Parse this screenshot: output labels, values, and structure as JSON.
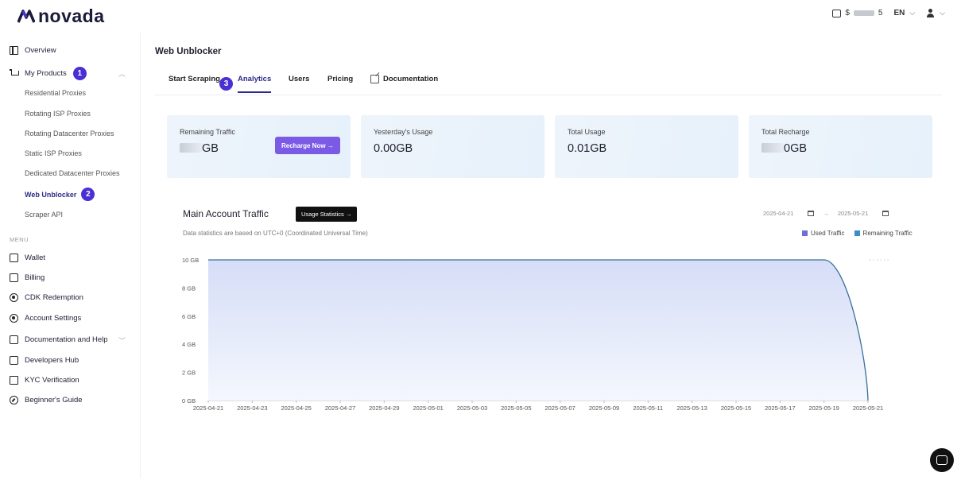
{
  "header": {
    "logo_text": "novada",
    "balance_prefix": "$",
    "balance_suffix": "5",
    "language": "EN"
  },
  "sidebar": {
    "overview": "Overview",
    "my_products": "My Products",
    "products_badge": "1",
    "products": [
      "Residential Proxies",
      "Rotating ISP Proxies",
      "Rotating Datacenter Proxies",
      "Static ISP Proxies",
      "Dedicated Datacenter Proxies",
      "Web Unblocker",
      "Scraper API"
    ],
    "active_product_badge": "2",
    "menu_label": "MENU",
    "menu": [
      "Wallet",
      "Billing",
      "CDK Redemption",
      "Account Settings",
      "Documentation and Help",
      "Developers Hub",
      "KYC Verification",
      "Beginner's Guide"
    ]
  },
  "page": {
    "title": "Web Unblocker",
    "tabs": [
      "Start Scraping",
      "Analytics",
      "Users",
      "Pricing",
      "Documentation"
    ],
    "tab_badge": "3"
  },
  "cards": [
    {
      "label": "Remaining Traffic",
      "value_suffix": "GB",
      "button": "Recharge Now →"
    },
    {
      "label": "Yesterday's Usage",
      "value": "0.00GB"
    },
    {
      "label": "Total Usage",
      "value": "0.01GB"
    },
    {
      "label": "Total Recharge",
      "value_suffix": "0GB"
    }
  ],
  "chart_section": {
    "title": "Main Account Traffic",
    "button": "Usage Statistics →",
    "note": "Data statistics are based on UTC+0 (Coordinated Universal Time)",
    "date_from": "2025-04-21",
    "date_sep": "→",
    "date_to": "2025-05-21"
  },
  "colors": {
    "accent": "#2d2b8a",
    "badge": "#4a2fd4",
    "used_traffic": "#6b6fd6",
    "remaining_traffic": "#3a8fc8",
    "recharge_button": "#7b5be6"
  },
  "chart_data": {
    "type": "area",
    "x": [
      "2025-04-21",
      "2025-04-23",
      "2025-04-25",
      "2025-04-27",
      "2025-04-29",
      "2025-05-01",
      "2025-05-03",
      "2025-05-05",
      "2025-05-07",
      "2025-05-09",
      "2025-05-11",
      "2025-05-13",
      "2025-05-15",
      "2025-05-17",
      "2025-05-19",
      "2025-05-21"
    ],
    "y_ticks": [
      "0 GB",
      "2 GB",
      "4 GB",
      "6 GB",
      "8 GB",
      "10 GB"
    ],
    "ylim": [
      0,
      10
    ],
    "series": [
      {
        "name": "Used Traffic",
        "values": [
          10,
          10,
          10,
          10,
          10,
          10,
          10,
          10,
          10,
          10,
          10,
          10,
          10,
          10,
          10,
          0
        ]
      },
      {
        "name": "Remaining Traffic",
        "values": []
      }
    ],
    "grid": false,
    "legend": "top-right"
  }
}
